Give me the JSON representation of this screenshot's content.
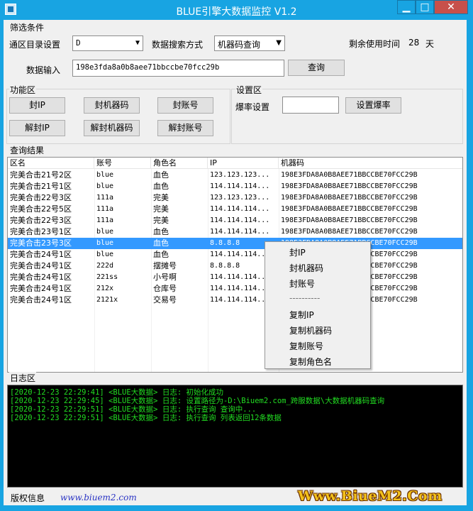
{
  "window": {
    "title": "BLUE引擎大数据监控 V1.2",
    "min_glyph": "▁",
    "max_glyph": "□",
    "close_glyph": "✕"
  },
  "filter": {
    "group_label": "筛选条件",
    "dir_label": "通区目录设置",
    "dir_value": "D",
    "search_mode_label": "数据搜索方式",
    "search_mode_value": "机器码查询",
    "remaining_label": "剩余使用时间",
    "remaining_value": "28",
    "remaining_unit": "天",
    "data_input_label": "数据输入",
    "data_input_value": "198e3fda8a0b8aee71bbccbe70fcc29b",
    "query_button": "查询"
  },
  "functions": {
    "group_label": "功能区",
    "ban_ip": "封IP",
    "ban_machine": "封机器码",
    "ban_account": "封账号",
    "unban_ip": "解封IP",
    "unban_machine": "解封机器码",
    "unban_account": "解封账号"
  },
  "settings": {
    "group_label": "设置区",
    "burst_label": "爆率设置",
    "burst_value": "",
    "burst_button": "设置爆率"
  },
  "results": {
    "group_label": "查询结果",
    "columns": [
      "区名",
      "账号",
      "角色名",
      "IP",
      "机器码"
    ],
    "rows": [
      [
        "完美合击21号2区",
        "blue",
        "血色",
        "123.123.123...",
        "198E3FDA8A0B8AEE71BBCCBE70FCC29B"
      ],
      [
        "完美合击21号1区",
        "blue",
        "血色",
        "114.114.114...",
        "198E3FDA8A0B8AEE71BBCCBE70FCC29B"
      ],
      [
        "完美合击22号3区",
        "111a",
        "完美",
        "123.123.123...",
        "198E3FDA8A0B8AEE71BBCCBE70FCC29B"
      ],
      [
        "完美合击22号5区",
        "111a",
        "完美",
        "114.114.114...",
        "198E3FDA8A0B8AEE71BBCCBE70FCC29B"
      ],
      [
        "完美合击22号3区",
        "111a",
        "完美",
        "114.114.114...",
        "198E3FDA8A0B8AEE71BBCCBE70FCC29B"
      ],
      [
        "完美合击23号1区",
        "blue",
        "血色",
        "114.114.114...",
        "198E3FDA8A0B8AEE71BBCCBE70FCC29B"
      ],
      [
        "完美合击23号3区",
        "blue",
        "血色",
        "8.8.8.8",
        "198E3FDA8A0B8AEE71BBCCBE70FCC29B"
      ],
      [
        "完美合击24号1区",
        "blue",
        "血色",
        "114.114.114...",
        "198E3FDA8A0B8AEE71BBCCBE70FCC29B"
      ],
      [
        "完美合击24号1区",
        "222d",
        "摆摊号",
        "8.8.8.8",
        "198E3FDA8A0B8AEE71BBCCBE70FCC29B"
      ],
      [
        "完美合击24号1区",
        "221ss",
        "小号啊",
        "114.114.114...",
        "198E3FDA8A0B8AEE71BBCCBE70FCC29B"
      ],
      [
        "完美合击24号1区",
        "212x",
        "仓库号",
        "114.114.114...",
        "198E3FDA8A0B8AEE71BBCCBE70FCC29B"
      ],
      [
        "完美合击24号1区",
        "2121x",
        "交易号",
        "114.114.114...",
        "198E3FDA8A0B8AEE71BBCCBE70FCC29B"
      ]
    ],
    "selected_row": 6
  },
  "context_menu": {
    "items": [
      "封IP",
      "封机器码",
      "封账号",
      "----------",
      "复制IP",
      "复制机器码",
      "复制账号",
      "复制角色名"
    ]
  },
  "log": {
    "group_label": "日志区",
    "lines": [
      "[2020-12-23 22:29:41] <BLUE大数据> 日志: 初始化成功",
      "[2020-12-23 22:29:45] <BLUE大数据> 日志: 设置路径为-D:\\Biuem2.com_跨服数据\\大数据机器码查询",
      "[2020-12-23 22:29:51] <BLUE大数据> 日志: 执行查询 查询中...",
      "[2020-12-23 22:29:51] <BLUE大数据> 日志: 执行查询 列表返回12条数据"
    ]
  },
  "footer": {
    "copyright_label": "版权信息",
    "link": "www.biuem2.com",
    "brand": "Www.BiueM2.Com"
  },
  "colors": {
    "titlebar": "#18a4e2",
    "selection": "#3399ff",
    "log_text": "#22dd22",
    "close": "#c7504b"
  }
}
